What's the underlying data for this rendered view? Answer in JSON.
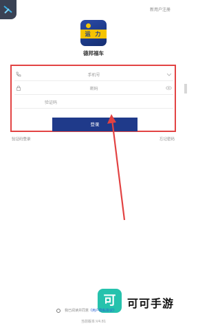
{
  "header": {
    "new_user_text": "新用户注册"
  },
  "app": {
    "name": "德邦福车",
    "logo_text": "运 力"
  },
  "form": {
    "phone_placeholder": "手机号",
    "password_placeholder": "密码",
    "code_placeholder": "验证码",
    "login_label": "登录"
  },
  "links": {
    "code_login": "验证码登录",
    "forgot_password": "忘记密码"
  },
  "agreement": {
    "prefix": "我已阅读并同意",
    "link": "《用户隐私协议》"
  },
  "version": "当前版本:V4.81",
  "watermark": {
    "icon_glyph": "可",
    "text": "可可手游"
  },
  "colors": {
    "brand_blue": "#1f3a8a",
    "brand_yellow": "#f5c400",
    "annotation_red": "#e24242",
    "watermark_teal": "#26c2ad"
  },
  "icons": [
    "app-switch-icon",
    "phone-icon",
    "lock-icon",
    "chevron-down-icon",
    "eye-icon",
    "radio-icon",
    "annotation-arrow"
  ]
}
